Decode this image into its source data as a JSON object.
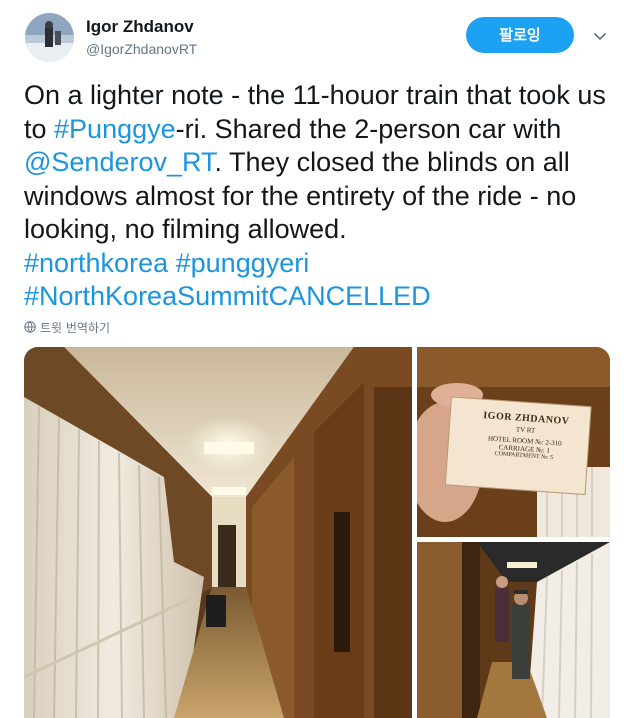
{
  "user": {
    "name": "Igor Zhdanov",
    "handle": "@IgorZhdanovRT"
  },
  "follow_label": "팔로잉",
  "tweet": {
    "text_start": "On a lighter note - the 11-houor train that took us to ",
    "hashtag_punggye": "#Punggye",
    "text_mid1": "-ri.  Shared the 2-person car with ",
    "mention": "@Senderov_RT",
    "text_mid2": ". They closed the blinds on all  windows almost for the entirety of the ride - no looking, no filming  allowed.",
    "hashtag_northkorea": "#northkorea",
    "hashtag_punggyeri": "#punggyeri",
    "hashtag_summit": "#NorthKoreaSummitCANCELLED"
  },
  "translate_label": "트윗 번역하기",
  "ticket": {
    "name": "IGOR   ZHDANOV",
    "outlet": "TV RT",
    "room": "HOTEL ROOM №: 2-310",
    "carriage": "CARRIAGE №: 1",
    "compartment": "COMPARTMENT №: 5"
  },
  "colors": {
    "accent": "#1da1f2",
    "link": "#1b95e0",
    "muted": "#657786"
  },
  "icons": [
    "avatar",
    "chevron-down-icon",
    "globe-icon"
  ]
}
